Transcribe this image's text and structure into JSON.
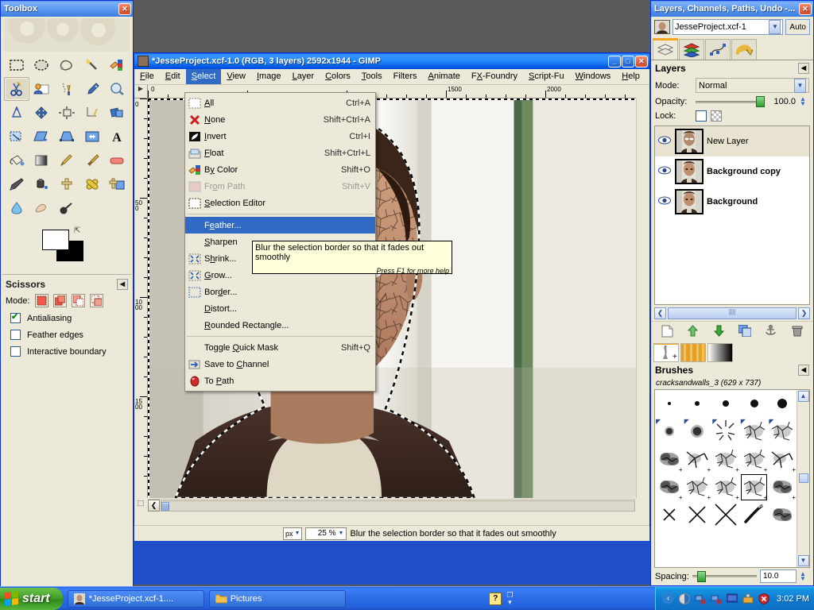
{
  "toolbox": {
    "title": "Toolbox",
    "close_label": "✕",
    "tools": [
      {
        "name": "rect-select-tool",
        "glyph": "▭"
      },
      {
        "name": "ellipse-select-tool",
        "glyph": "◯"
      },
      {
        "name": "free-select-tool",
        "glyph": "❍"
      },
      {
        "name": "fuzzy-select-tool",
        "glyph": "✦"
      },
      {
        "name": "select-by-color-tool",
        "glyph": "▦"
      },
      {
        "name": "scissors-select-tool",
        "glyph": "✂"
      },
      {
        "name": "foreground-select-tool",
        "glyph": "☺"
      },
      {
        "name": "paths-tool",
        "glyph": "✒"
      },
      {
        "name": "color-picker-tool",
        "glyph": "💧"
      },
      {
        "name": "zoom-tool",
        "glyph": "🔍"
      },
      {
        "name": "measure-tool",
        "glyph": "📐"
      },
      {
        "name": "move-tool",
        "glyph": "✛"
      },
      {
        "name": "align-tool",
        "glyph": "⊞"
      },
      {
        "name": "crop-tool",
        "glyph": "✂"
      },
      {
        "name": "rotate-tool",
        "glyph": "⟳"
      },
      {
        "name": "scale-tool",
        "glyph": "⤡"
      },
      {
        "name": "shear-tool",
        "glyph": "▱"
      },
      {
        "name": "perspective-tool",
        "glyph": "⬓"
      },
      {
        "name": "flip-tool",
        "glyph": "⇔"
      },
      {
        "name": "text-tool",
        "glyph": "A"
      },
      {
        "name": "bucket-fill-tool",
        "glyph": "🪣"
      },
      {
        "name": "gradient-tool",
        "glyph": "▤"
      },
      {
        "name": "pencil-tool",
        "glyph": "✏"
      },
      {
        "name": "paintbrush-tool",
        "glyph": "🖌"
      },
      {
        "name": "eraser-tool",
        "glyph": "▰"
      },
      {
        "name": "airbrush-tool",
        "glyph": "🖊"
      },
      {
        "name": "ink-tool",
        "glyph": "🖋"
      },
      {
        "name": "clone-tool",
        "glyph": "⚱"
      },
      {
        "name": "heal-tool",
        "glyph": "✚"
      },
      {
        "name": "perspective-clone-tool",
        "glyph": "⚱"
      },
      {
        "name": "blur-sharpen-tool",
        "glyph": "💧"
      },
      {
        "name": "smudge-tool",
        "glyph": "👆"
      },
      {
        "name": "dodge-burn-tool",
        "glyph": "🔦"
      }
    ],
    "active_tool_index": 5,
    "foreground_color": "#ffffff",
    "background_color": "#000000",
    "options": {
      "title": "Scissors",
      "mode_label": "Mode:",
      "modes": [
        "replace",
        "add",
        "subtract",
        "intersect"
      ],
      "selected_mode_index": 0,
      "checks": [
        {
          "label": "Antialiasing",
          "checked": true
        },
        {
          "label": "Feather edges",
          "checked": false
        },
        {
          "label": "Interactive boundary",
          "checked": false
        }
      ]
    }
  },
  "gimp_window": {
    "title": "*JesseProject.xcf-1.0 (RGB, 3 layers) 2592x1944 - GIMP",
    "minimize_label": "_",
    "maximize_label": "□",
    "close_label": "✕",
    "menus": [
      {
        "label": "File",
        "key": "F"
      },
      {
        "label": "Edit",
        "key": "E"
      },
      {
        "label": "Select",
        "key": "S",
        "open": true
      },
      {
        "label": "View",
        "key": "V"
      },
      {
        "label": "Image",
        "key": "I"
      },
      {
        "label": "Layer",
        "key": "L"
      },
      {
        "label": "Colors",
        "key": "C"
      },
      {
        "label": "Tools",
        "key": "T"
      },
      {
        "label": "Filters",
        "key": "R"
      },
      {
        "label": "Animate",
        "key": "A"
      },
      {
        "label": "FX-Foundry",
        "key": "X"
      },
      {
        "label": "Script-Fu",
        "key": "S"
      },
      {
        "label": "Windows",
        "key": "W"
      },
      {
        "label": "Help",
        "key": "H"
      }
    ],
    "ruler_h_labels": [
      "0",
      "1500",
      "2000"
    ],
    "ruler_v_labels": [
      "0",
      "500",
      "1000",
      "1500"
    ],
    "statusbar": {
      "unit": "px",
      "zoom": "25 %",
      "message": "Blur the selection border so that it fades out smoothly"
    }
  },
  "select_menu": {
    "items": [
      {
        "label": "All",
        "underline": "A",
        "accel": "Ctrl+A",
        "icon": "select-all-icon",
        "state": "normal"
      },
      {
        "label": "None",
        "underline": "N",
        "accel": "Shift+Ctrl+A",
        "icon": "select-none-icon",
        "state": "normal"
      },
      {
        "label": "Invert",
        "underline": "I",
        "accel": "Ctrl+I",
        "icon": "select-invert-icon",
        "state": "normal"
      },
      {
        "label": "Float",
        "underline": "F",
        "accel": "Shift+Ctrl+L",
        "icon": "select-float-icon",
        "state": "normal"
      },
      {
        "label": "By Color",
        "underline": "y",
        "accel": "Shift+O",
        "icon": "select-by-color-icon",
        "state": "normal"
      },
      {
        "label": "From Path",
        "underline": "o",
        "accel": "Shift+V",
        "icon": "from-path-icon",
        "state": "disabled"
      },
      {
        "label": "Selection Editor",
        "underline": "S",
        "accel": "",
        "icon": "selection-editor-icon",
        "state": "normal"
      },
      {
        "separator": true
      },
      {
        "label": "Feather...",
        "underline": "e",
        "accel": "",
        "icon": "",
        "state": "highlighted"
      },
      {
        "label": "Sharpen",
        "underline": "S",
        "accel": "",
        "icon": "",
        "state": "normal"
      },
      {
        "label": "Shrink...",
        "underline": "h",
        "accel": "",
        "icon": "shrink-icon",
        "state": "normal"
      },
      {
        "label": "Grow...",
        "underline": "G",
        "accel": "",
        "icon": "grow-icon",
        "state": "normal"
      },
      {
        "label": "Border...",
        "underline": "d",
        "accel": "",
        "icon": "border-icon",
        "state": "normal"
      },
      {
        "label": "Distort...",
        "underline": "D",
        "accel": "",
        "icon": "",
        "state": "normal"
      },
      {
        "label": "Rounded Rectangle...",
        "underline": "R",
        "accel": "",
        "icon": "",
        "state": "normal"
      },
      {
        "separator": true
      },
      {
        "label": "Toggle Quick Mask",
        "underline": "Q",
        "accel": "Shift+Q",
        "icon": "",
        "state": "normal"
      },
      {
        "label": "Save to Channel",
        "underline": "C",
        "accel": "",
        "icon": "save-to-channel-icon",
        "state": "normal"
      },
      {
        "label": "To Path",
        "underline": "P",
        "accel": "",
        "icon": "to-path-icon",
        "state": "normal"
      }
    ]
  },
  "tooltip": {
    "text": "Blur the selection border so that it fades out smoothly",
    "hint": "Press F1 for more help"
  },
  "dock": {
    "title": "Layers, Channels, Paths, Undo -...",
    "close_label": "✕",
    "image_name": "JesseProject.xcf-1",
    "auto_label": "Auto",
    "tabs": [
      {
        "name": "layers-tab",
        "active": true
      },
      {
        "name": "channels-tab",
        "active": false
      },
      {
        "name": "paths-tab",
        "active": false
      },
      {
        "name": "undo-history-tab",
        "active": false
      }
    ],
    "layers_panel": {
      "title": "Layers",
      "mode_label": "Mode:",
      "mode_value": "Normal",
      "opacity_label": "Opacity:",
      "opacity_value": "100.0",
      "lock_label": "Lock:",
      "layers": [
        {
          "name": "New Layer",
          "visible": true,
          "selected": true
        },
        {
          "name": "Background copy",
          "visible": true,
          "selected": false
        },
        {
          "name": "Background",
          "visible": true,
          "selected": false
        }
      ],
      "buttons": [
        {
          "name": "new-layer-button",
          "glyph": "🗋"
        },
        {
          "name": "raise-layer-button",
          "glyph": "⬆"
        },
        {
          "name": "lower-layer-button",
          "glyph": "⬇"
        },
        {
          "name": "duplicate-layer-button",
          "glyph": "⧉"
        },
        {
          "name": "anchor-layer-button",
          "glyph": "⚓"
        },
        {
          "name": "delete-layer-button",
          "glyph": "🗑"
        }
      ]
    },
    "brush_tabs": [
      {
        "name": "brushes-tab",
        "active": true
      },
      {
        "name": "patterns-tab",
        "active": false
      },
      {
        "name": "gradients-tab",
        "active": false
      }
    ],
    "brushes_panel": {
      "title": "Brushes",
      "selected_brush": "cracksandwalls_3 (629 x 737)",
      "spacing_label": "Spacing:",
      "spacing_value": "10.0",
      "selected_brush_index": 18,
      "cells": [
        {
          "kind": "dot",
          "size": 4
        },
        {
          "kind": "dot",
          "size": 6
        },
        {
          "kind": "dot",
          "size": 8
        },
        {
          "kind": "dot",
          "size": 10
        },
        {
          "kind": "dot",
          "size": 12
        },
        {
          "kind": "fuzz",
          "size": 12,
          "mark": "tl"
        },
        {
          "kind": "fuzz",
          "size": 16,
          "mark": "tl"
        },
        {
          "kind": "spark",
          "size": 20,
          "mark": "tl"
        },
        {
          "kind": "crack",
          "size": 22,
          "mark": "tl"
        },
        {
          "kind": "crack",
          "size": 22,
          "mark": "tl"
        },
        {
          "kind": "cloud",
          "size": 24,
          "mark": "br"
        },
        {
          "kind": "branch",
          "size": 24,
          "mark": "br"
        },
        {
          "kind": "crack",
          "size": 24,
          "mark": "br"
        },
        {
          "kind": "crack",
          "size": 24,
          "mark": "br"
        },
        {
          "kind": "branch",
          "size": 24,
          "mark": "br"
        },
        {
          "kind": "cloud",
          "size": 24,
          "mark": "br"
        },
        {
          "kind": "crack",
          "size": 24,
          "mark": "br"
        },
        {
          "kind": "crack",
          "size": 24,
          "mark": "br"
        },
        {
          "kind": "crack",
          "size": 24,
          "mark": "br"
        },
        {
          "kind": "cloud",
          "size": 24,
          "mark": "br"
        },
        {
          "kind": "x",
          "size": 14
        },
        {
          "kind": "x",
          "size": 20
        },
        {
          "kind": "x",
          "size": 26
        },
        {
          "kind": "stroke",
          "size": 22
        },
        {
          "kind": "cloud",
          "size": 22
        }
      ]
    }
  },
  "taskbar": {
    "start_label": "start",
    "tasks": [
      {
        "label": "*JesseProject.xcf-1....",
        "icon": "gimp-image-icon",
        "active": true
      },
      {
        "label": "Pictures",
        "icon": "folder-icon",
        "active": false
      }
    ],
    "tray_icons": [
      {
        "name": "help-icon",
        "glyph": "?"
      },
      {
        "name": "show-hidden-icon",
        "glyph": "‹"
      },
      {
        "name": "shield-icon",
        "glyph": "◐"
      },
      {
        "name": "network-disconnected-icon",
        "glyph": "🖧"
      },
      {
        "name": "network-disconnected-2-icon",
        "glyph": "🖧"
      },
      {
        "name": "display-icon",
        "glyph": "▦"
      },
      {
        "name": "safely-remove-icon",
        "glyph": "⏏"
      },
      {
        "name": "antivirus-icon",
        "glyph": "✖"
      }
    ],
    "clock": "3:02 PM"
  },
  "colors": {
    "title_blue": "#0058ee",
    "menu_highlight": "#316ac5",
    "panel_bg": "#ece9d8",
    "tooltip_bg": "#ffffdc",
    "taskbar_blue": "#2f6fd8",
    "start_green": "#44a02a"
  }
}
